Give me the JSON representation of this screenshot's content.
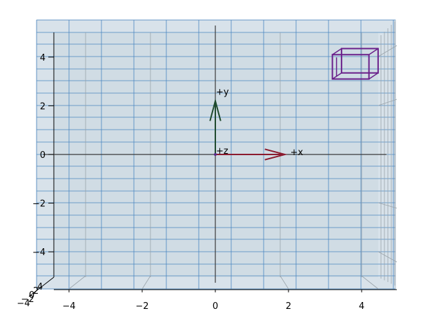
{
  "chart_data": {
    "type": "3d-quiver",
    "view": "top-down orthographic, looking along -z",
    "grid": true,
    "background": "#d8e2ea",
    "xlim": [
      -4.5,
      5
    ],
    "ylim": [
      -5.2,
      5.2
    ],
    "x_ticks": [
      "−4",
      "−2",
      "0",
      "2",
      "4"
    ],
    "y_ticks": [
      "4",
      "2",
      "0",
      "−2",
      "−4"
    ],
    "z_ticks": [
      "−4",
      "−2",
      "0",
      "2",
      "4"
    ],
    "axis_arrows": [
      {
        "label": "+x",
        "from": [
          0,
          0,
          0
        ],
        "to": [
          2,
          0,
          0
        ],
        "color": "#8b1a2e"
      },
      {
        "label": "+y",
        "from": [
          0,
          0,
          0
        ],
        "to": [
          0,
          2,
          0
        ],
        "color": "#1f4a2e"
      },
      {
        "label": "+z",
        "from": [
          0,
          0,
          0
        ],
        "to": [
          0,
          0,
          2
        ],
        "color": "#5a2a8a"
      }
    ],
    "box": {
      "color": "#6a1f8a",
      "x_range": [
        3.2,
        4.2
      ],
      "y_range": [
        3.1,
        4.1
      ],
      "offset": [
        0.25,
        0.25
      ]
    }
  }
}
